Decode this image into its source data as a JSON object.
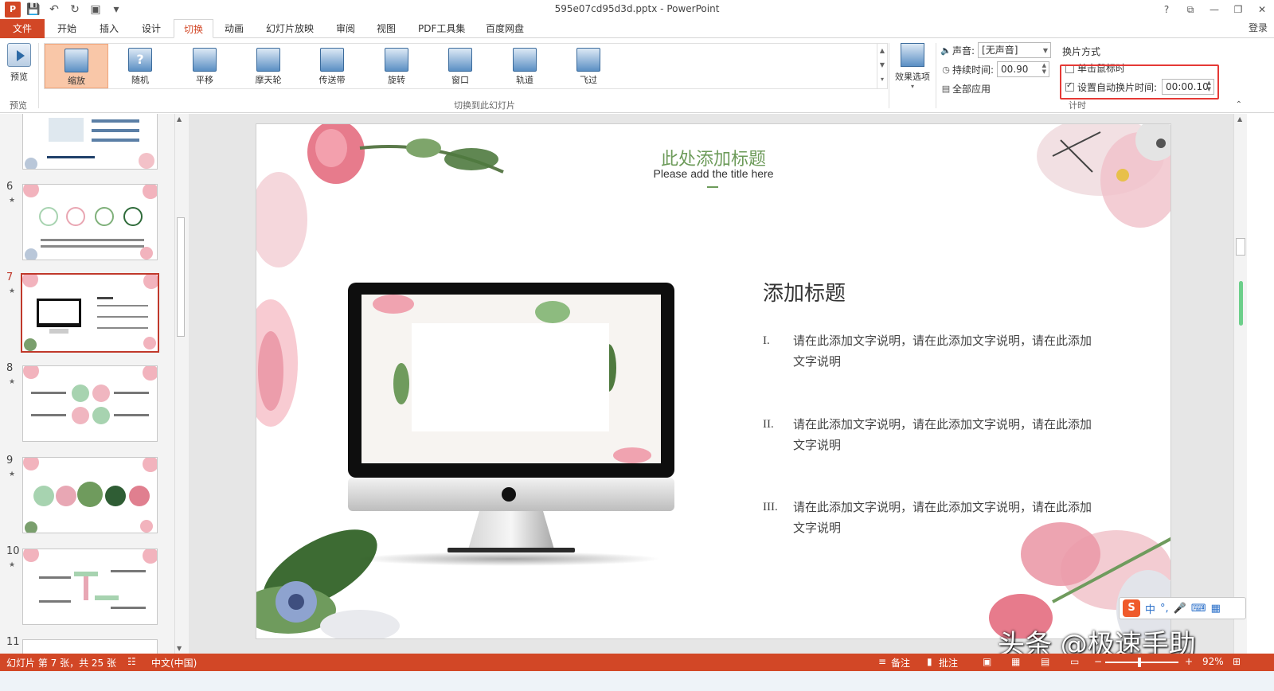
{
  "window": {
    "title": "595e07cd95d3d.pptx - PowerPoint",
    "controls": [
      "?",
      "⧉",
      "—",
      "❐",
      "✕"
    ]
  },
  "qat": {
    "logo": "P",
    "save": "💾",
    "undo": "↶",
    "redo": "↻",
    "present": "▣",
    "more": "▾"
  },
  "ribbon_tabs": [
    "文件",
    "开始",
    "插入",
    "设计",
    "切换",
    "动画",
    "幻灯片放映",
    "审阅",
    "视图",
    "PDF工具集",
    "百度网盘"
  ],
  "login": "登录",
  "ribbon": {
    "preview_label": "预览",
    "preview_group": "预览",
    "transitions": [
      "缩放",
      "随机",
      "平移",
      "摩天轮",
      "传送带",
      "旋转",
      "窗口",
      "轨道",
      "飞过"
    ],
    "gallery_group": "切换到此幻灯片",
    "effect_options": "效果选项",
    "sound_label": "声音:",
    "sound_value": "[无声音]",
    "duration_label": "持续时间:",
    "duration_value": "00.90",
    "apply_all": "全部应用",
    "advance_title": "换片方式",
    "on_click_label": "单击鼠标时",
    "on_click_checked": false,
    "auto_label": "设置自动换片时间:",
    "auto_checked": true,
    "auto_value": "00:00.10",
    "timing_group": "计时"
  },
  "slides_panel": {
    "items": [
      {
        "number": "6",
        "star": "★"
      },
      {
        "number": "7",
        "star": "★",
        "selected": true
      },
      {
        "number": "8",
        "star": "★"
      },
      {
        "number": "9",
        "star": "★"
      },
      {
        "number": "10",
        "star": "★"
      },
      {
        "number": "11",
        "star": ""
      }
    ]
  },
  "slide": {
    "title": "此处添加标题",
    "subtitle": "Please add the title here",
    "heading": "添加标题",
    "items": [
      {
        "roman": "I.",
        "text": "请在此添加文字说明，请在此添加文字说明，请在此添加文字说明"
      },
      {
        "roman": "II.",
        "text": "请在此添加文字说明，请在此添加文字说明，请在此添加文字说明"
      },
      {
        "roman": "III.",
        "text": "请在此添加文字说明，请在此添加文字说明，请在此添加文字说明"
      }
    ]
  },
  "status": {
    "slide_info": "幻灯片 第 7 张，共 25 张",
    "language": "中文(中国)",
    "notes": "备注",
    "comments": "批注",
    "zoom": "92%"
  },
  "ime": {
    "logo": "S",
    "mode": "中",
    "icons": [
      "°,",
      "🎤",
      "⌨",
      "▦"
    ]
  },
  "watermark": "头条 @极速手助"
}
